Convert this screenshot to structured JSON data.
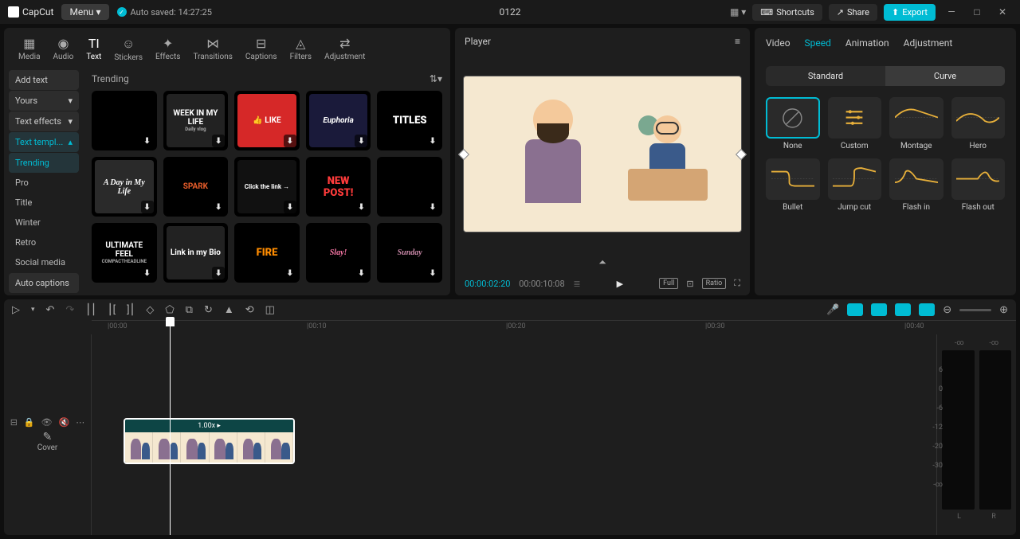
{
  "app": {
    "name": "CapCut",
    "menu": "Menu ▾",
    "autosave": "Auto saved: 14:27:25",
    "project": "0122"
  },
  "titlebar": {
    "shortcuts": "Shortcuts",
    "share": "Share",
    "export": "Export"
  },
  "tools": [
    {
      "label": "Media",
      "icon": "▦"
    },
    {
      "label": "Audio",
      "icon": "◉"
    },
    {
      "label": "Text",
      "icon": "TI",
      "active": true
    },
    {
      "label": "Stickers",
      "icon": "☺"
    },
    {
      "label": "Effects",
      "icon": "✦"
    },
    {
      "label": "Transitions",
      "icon": "⋈"
    },
    {
      "label": "Captions",
      "icon": "⊟"
    },
    {
      "label": "Filters",
      "icon": "◬"
    },
    {
      "label": "Adjustment",
      "icon": "⇄"
    }
  ],
  "sidebar": {
    "add_text": "Add text",
    "yours": "Yours",
    "effects": "Text effects",
    "templates": "Text templ...",
    "subs": [
      "Trending",
      "Pro",
      "Title",
      "Winter",
      "Retro",
      "Social media"
    ],
    "auto": "Auto captions"
  },
  "grid": {
    "heading": "Trending",
    "items": [
      {
        "t": "",
        "bg": "#000"
      },
      {
        "t": "WEEK IN MY LIFE",
        "bg": "#222",
        "small": "Daily vlog"
      },
      {
        "t": "👍 LIKE",
        "bg": "#d62828"
      },
      {
        "t": "Euphoria",
        "bg": "#1a1a3a",
        "ital": true
      },
      {
        "t": "TITLES",
        "bg": "#000",
        "color": "#fff",
        "big": true
      },
      {
        "t": "A Day in My Life",
        "bg": "#2a2a2a",
        "script": true
      },
      {
        "t": "SPARK",
        "bg": "#000",
        "color": "#e85d2a"
      },
      {
        "t": "Click the link →",
        "bg": "#111",
        "sm": true
      },
      {
        "t": "NEW POST!",
        "bg": "#000",
        "color": "#ff3b3b",
        "big": true
      },
      {
        "t": "",
        "bg": "#000"
      },
      {
        "t": "ULTIMATE FEEL",
        "bg": "#000",
        "small": "COMPACTHEADLINE"
      },
      {
        "t": "Link in my Bio",
        "bg": "#222"
      },
      {
        "t": "FIRE",
        "bg": "#000",
        "color": "#ff8c00",
        "big": true
      },
      {
        "t": "Slay!",
        "bg": "#000",
        "color": "#ff7aaa",
        "script": true
      },
      {
        "t": "Sunday",
        "bg": "#000",
        "color": "#cc8aaa",
        "script": true
      }
    ]
  },
  "player": {
    "title": "Player",
    "time": "00:00:02:20",
    "dur": "00:00:10:08",
    "full": "Full",
    "ratio": "Ratio"
  },
  "right": {
    "tabs": [
      "Video",
      "Speed",
      "Animation",
      "Adjustment"
    ],
    "active": 1,
    "seg": [
      "Standard",
      "Curve"
    ],
    "seg_active": 1,
    "curves": [
      "None",
      "Custom",
      "Montage",
      "Hero",
      "Bullet",
      "Jump cut",
      "Flash in",
      "Flash out"
    ]
  },
  "timeline": {
    "marks": [
      "|00:00",
      "|00:10",
      "|00:20",
      "|00:30",
      "|00:40"
    ],
    "cover": "Cover",
    "clip_speed": "1.00x ▸"
  },
  "meter": {
    "vals": [
      "6",
      "0",
      "-6",
      "-12",
      "-20",
      "-30",
      "-∞"
    ],
    "L": "L",
    "R": "R",
    "top": "-∞"
  }
}
